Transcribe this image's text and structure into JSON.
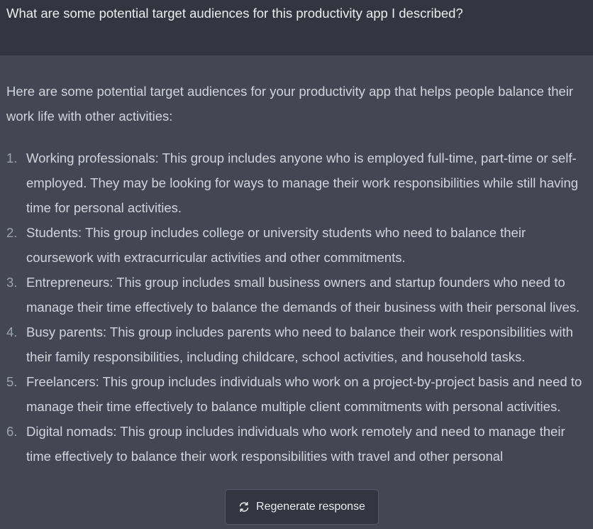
{
  "user_message": {
    "text": "What are some potential target audiences for this productivity app I described?"
  },
  "assistant_message": {
    "intro": "Here are some potential target audiences for your productivity app that helps people balance their work life with other activities:",
    "items": [
      {
        "number": "1.",
        "text": "Working professionals: This group includes anyone who is employed full-time, part-time or self-employed. They may be looking for ways to manage their work responsibilities while still having time for personal activities."
      },
      {
        "number": "2.",
        "text": "Students: This group includes college or university students who need to balance their coursework with extracurricular activities and other commitments."
      },
      {
        "number": "3.",
        "text": "Entrepreneurs: This group includes small business owners and startup founders who need to manage their time effectively to balance the demands of their business with their personal lives."
      },
      {
        "number": "4.",
        "text": "Busy parents: This group includes parents who need to balance their work responsibilities with their family responsibilities, including childcare, school activities, and household tasks."
      },
      {
        "number": "5.",
        "text": "Freelancers: This group includes individuals who work on a project-by-project basis and need to manage their time effectively to balance multiple client commitments with personal activities."
      },
      {
        "number": "6.",
        "text": "Digital nomads: This group includes individuals who work remotely and need to manage their time effectively to balance their work responsibilities with travel and other personal"
      }
    ]
  },
  "regenerate_button": {
    "label": "Regenerate response",
    "icon": "refresh-icon"
  },
  "colors": {
    "user_bg": "#343541",
    "assistant_bg": "#444654",
    "text": "#d1d5db",
    "button_bg": "#343541",
    "button_border": "#565869"
  }
}
